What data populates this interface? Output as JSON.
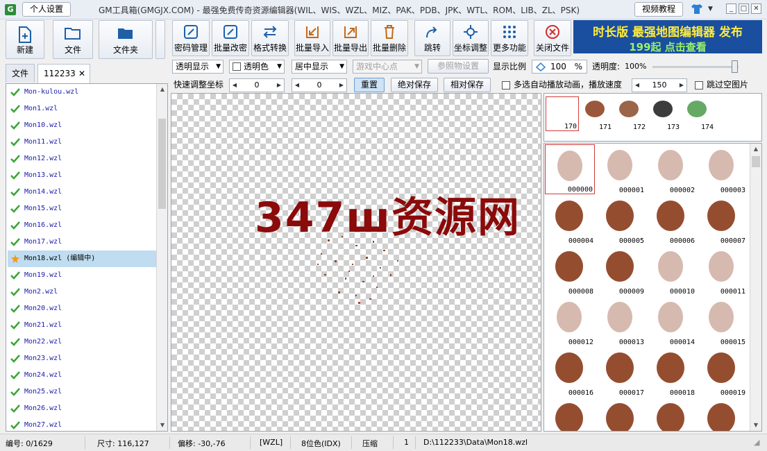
{
  "titlebar": {
    "app_icon": "G",
    "personal_button": "个人设置",
    "title": "GM工具箱(GMGJX.COM) - 最强免费传奇资源编辑器(WIL、WIS、WZL、MIZ、PAK、PDB、JPK、WTL、ROM、LIB、ZL、PSK)",
    "video_button": "视频教程",
    "min": "_",
    "max": "□",
    "close": "✕"
  },
  "left_toolbar": {
    "new": "新建",
    "file": "文件",
    "folder": "文件夹"
  },
  "toolbar": {
    "password": "密码管理",
    "batch_password": "批量改密",
    "format_convert": "格式转换",
    "batch_import": "批量导入",
    "batch_export": "批量导出",
    "batch_delete": "批量删除",
    "jump": "跳转",
    "coord_adjust": "坐标调整",
    "more": "更多功能",
    "close_file": "关闭文件"
  },
  "banner": {
    "line1": "时长版  最强地图编辑器  发布",
    "line2": "199起  点击查看"
  },
  "tabs": {
    "file": "文件",
    "current": "112233",
    "close": "✕"
  },
  "files": [
    {
      "name": "Mon-kulou.wzl",
      "editing": false
    },
    {
      "name": "Mon1.wzl",
      "editing": false
    },
    {
      "name": "Mon10.wzl",
      "editing": false
    },
    {
      "name": "Mon11.wzl",
      "editing": false
    },
    {
      "name": "Mon12.wzl",
      "editing": false
    },
    {
      "name": "Mon13.wzl",
      "editing": false
    },
    {
      "name": "Mon14.wzl",
      "editing": false
    },
    {
      "name": "Mon15.wzl",
      "editing": false
    },
    {
      "name": "Mon16.wzl",
      "editing": false
    },
    {
      "name": "Mon17.wzl",
      "editing": false
    },
    {
      "name": "Mon18.wzl (编辑中)",
      "editing": true
    },
    {
      "name": "Mon19.wzl",
      "editing": false
    },
    {
      "name": "Mon2.wzl",
      "editing": false
    },
    {
      "name": "Mon20.wzl",
      "editing": false
    },
    {
      "name": "Mon21.wzl",
      "editing": false
    },
    {
      "name": "Mon22.wzl",
      "editing": false
    },
    {
      "name": "Mon23.wzl",
      "editing": false
    },
    {
      "name": "Mon24.wzl",
      "editing": false
    },
    {
      "name": "Mon25.wzl",
      "editing": false
    },
    {
      "name": "Mon26.wzl",
      "editing": false
    },
    {
      "name": "Mon27.wzl",
      "editing": false
    }
  ],
  "controls": {
    "display_mode": "透明显示",
    "transparent_color": "透明色",
    "align": "居中显示",
    "game_center": "游戏中心点",
    "reference_setting": "参照物设置",
    "scale_label": "显示比例",
    "scale_value": "100",
    "scale_unit": "%",
    "opacity_label": "透明度:",
    "opacity_value": "100%",
    "opacity": 1.0,
    "quick_coord_label": "快速调整坐标",
    "coord_x": "0",
    "coord_y": "0",
    "reset": "重置",
    "abs_save": "绝对保存",
    "rel_save": "相对保存",
    "autoplay_label": "多选自动播放动画，播放速度",
    "speed": "150",
    "skip_empty": "跳过空图片"
  },
  "canvas": {
    "watermark": "347ш资源网"
  },
  "strip": [
    {
      "num": "170",
      "selected": true
    },
    {
      "num": "171",
      "selected": false
    },
    {
      "num": "172",
      "selected": false
    },
    {
      "num": "173",
      "selected": false
    },
    {
      "num": "174",
      "selected": false
    }
  ],
  "frames": [
    "000000",
    "000001",
    "000002",
    "000003",
    "000004",
    "000005",
    "000006",
    "000007",
    "000008",
    "000009",
    "000010",
    "000011",
    "000012",
    "000013",
    "000014",
    "000015",
    "000016",
    "000017",
    "000018",
    "000019",
    "",
    "",
    "",
    ""
  ],
  "status": {
    "index": "编号: 0/1629",
    "size": "尺寸: 116,127",
    "offset": "偏移: -30,-76",
    "format": "[WZL]",
    "depth": "8位色(IDX)",
    "compress": "压缩",
    "count": "1",
    "path": "D:\\112233\\Data\\Mon18.wzl"
  },
  "colors": {
    "watermark": "#8b0a0a",
    "banner_bg": "#1a4fa0",
    "selection": "#d23a3a",
    "editing_row": "#bfdcf0",
    "check": "#3aa53a"
  }
}
